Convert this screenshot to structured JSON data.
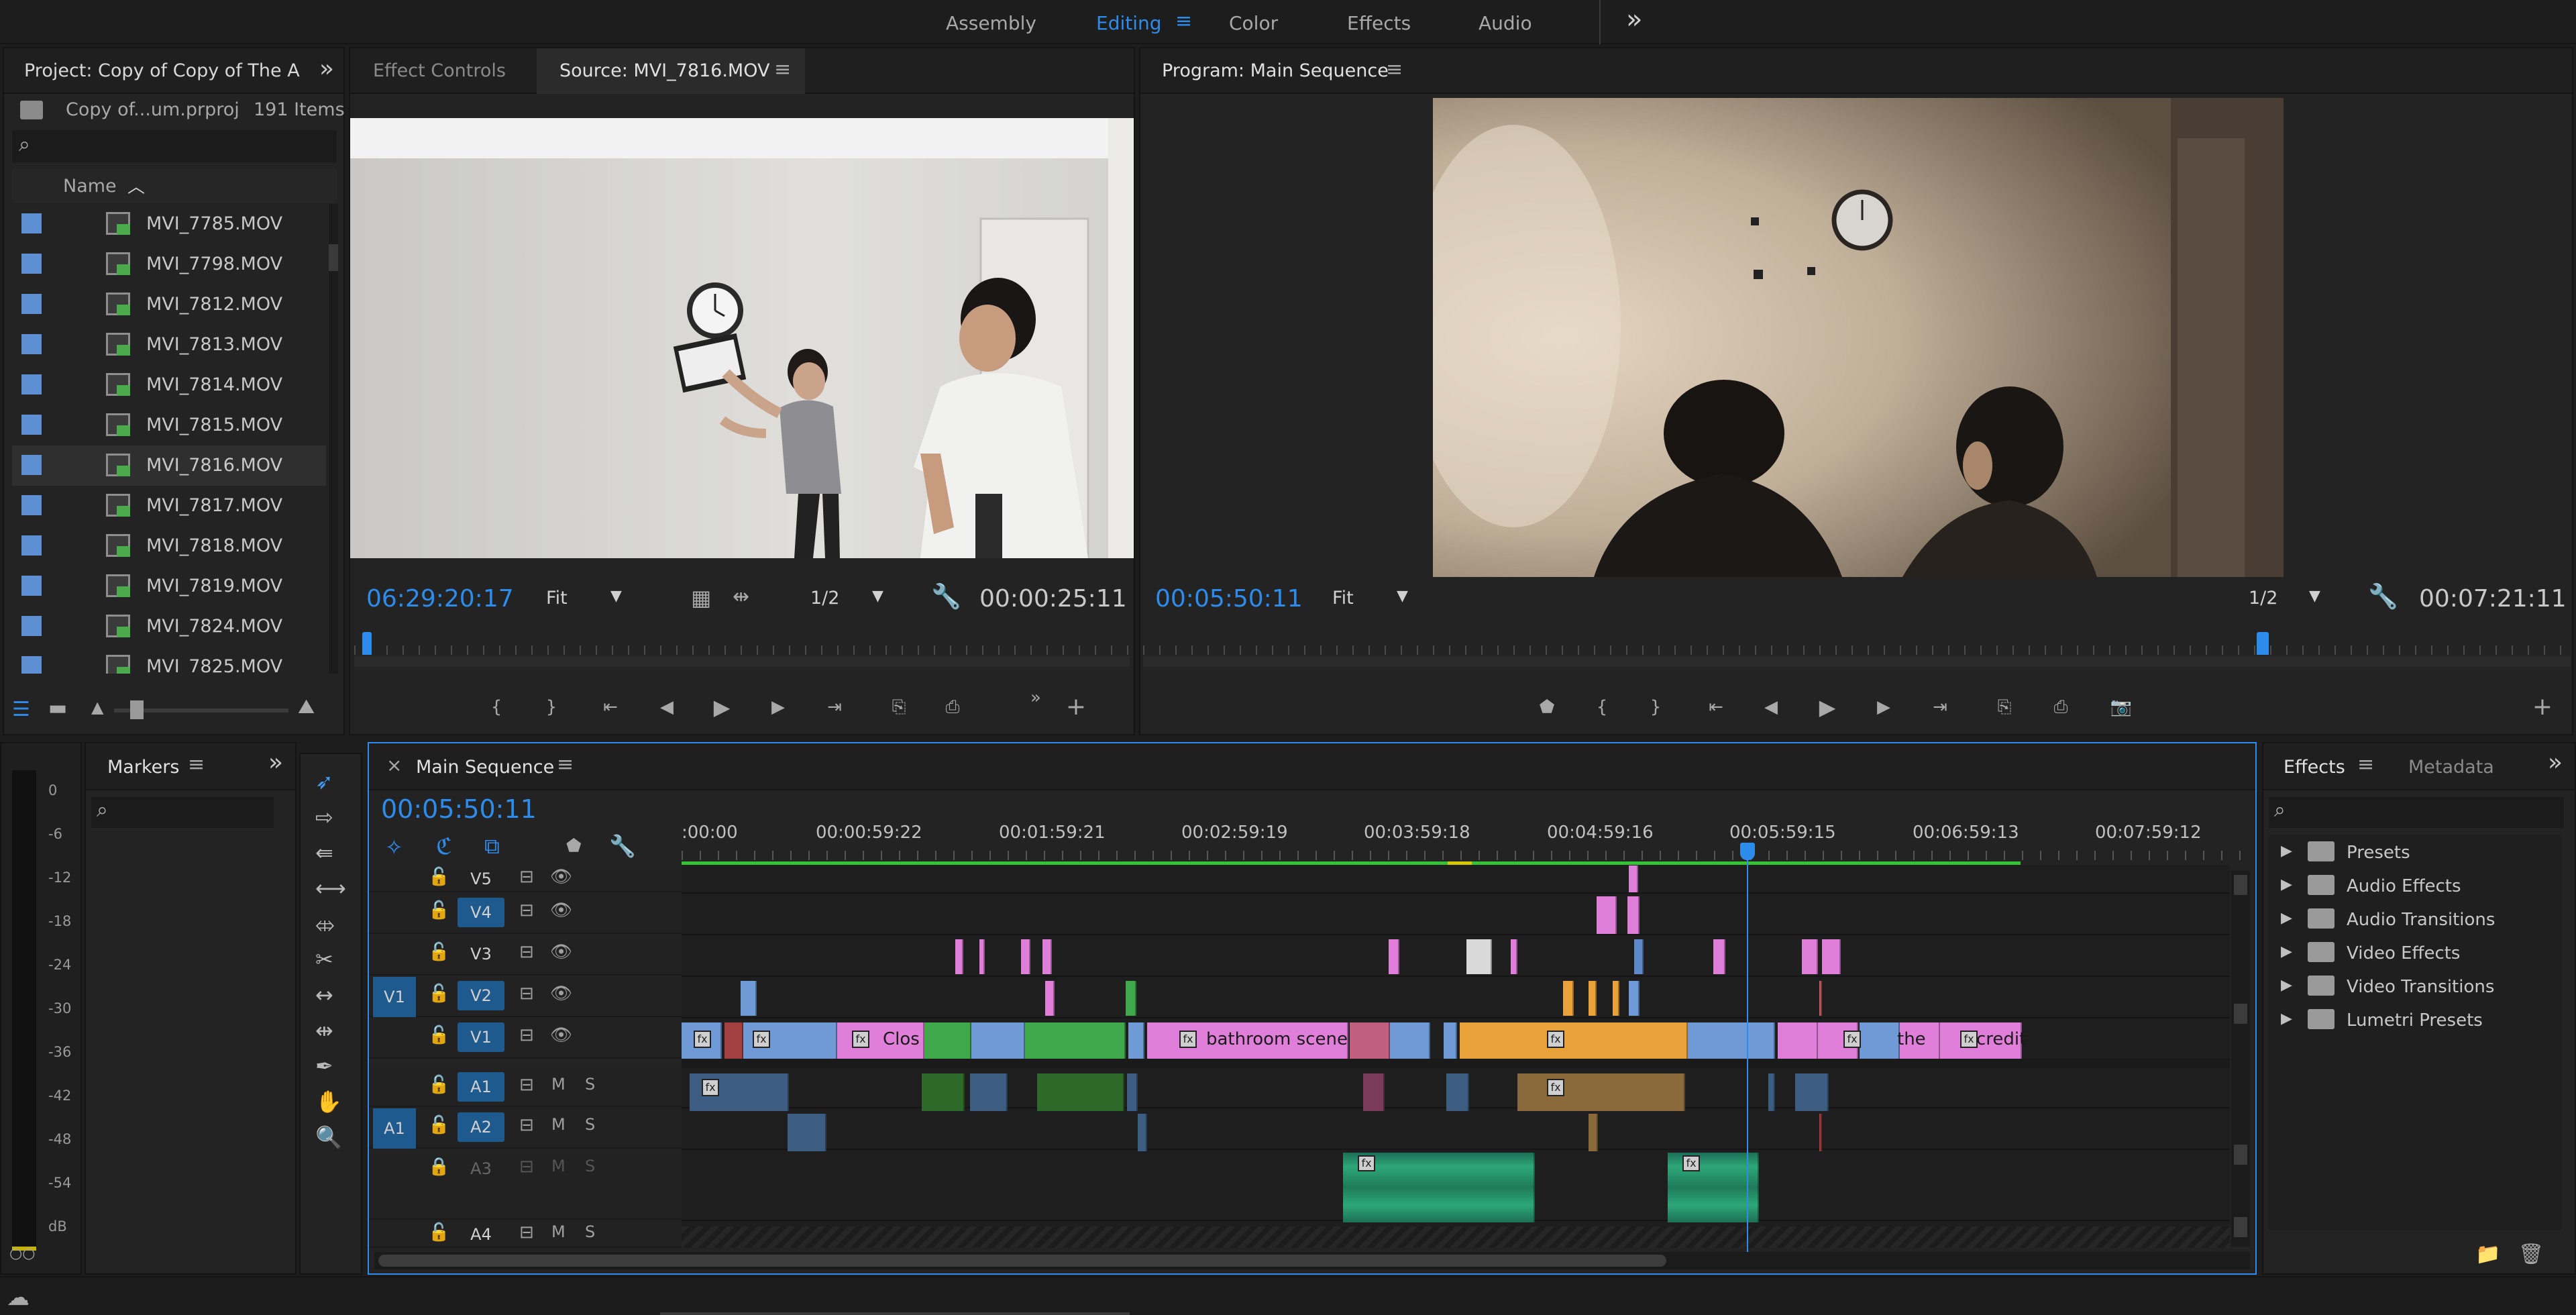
{
  "workspaces": {
    "tabs": [
      "Assembly",
      "Editing",
      "Color",
      "Effects",
      "Audio"
    ],
    "active": "Editing",
    "more": "»"
  },
  "project": {
    "title": "Project: Copy of Copy of The A",
    "file": "Copy of...um.prproj",
    "item_count": "191 Items",
    "column_name": "Name",
    "files": [
      "MVI_7785.MOV",
      "MVI_7798.MOV",
      "MVI_7812.MOV",
      "MVI_7813.MOV",
      "MVI_7814.MOV",
      "MVI_7815.MOV",
      "MVI_7816.MOV",
      "MVI_7817.MOV",
      "MVI_7818.MOV",
      "MVI_7819.MOV",
      "MVI_7824.MOV",
      "MVI_7825.MOV"
    ],
    "selected": "MVI_7816.MOV"
  },
  "source": {
    "tab_effect_controls": "Effect Controls",
    "tab_source": "Source: MVI_7816.MOV",
    "timecode": "06:29:20:17",
    "fit": "Fit",
    "resolution": "1/2",
    "duration": "00:00:25:11",
    "playhead_fraction": 0.01
  },
  "program": {
    "title": "Program: Main Sequence",
    "timecode": "00:05:50:11",
    "fit": "Fit",
    "resolution": "1/2",
    "duration": "00:07:21:11",
    "playhead_fraction": 0.78
  },
  "markers": {
    "title": "Markers"
  },
  "audio_meter": {
    "labels": [
      "0",
      "-6",
      "-12",
      "-18",
      "-24",
      "-30",
      "-36",
      "-42",
      "-48",
      "-54",
      "dB"
    ]
  },
  "timeline": {
    "title": "Main Sequence",
    "timecode": "00:05:50:11",
    "ruler": [
      ":00:00",
      "00:00:59:22",
      "00:01:59:21",
      "00:02:59:19",
      "00:03:59:18",
      "00:04:59:16",
      "00:05:59:15",
      "00:06:59:13",
      "00:07:59:12"
    ],
    "video_tracks": [
      "V5",
      "V4",
      "V3",
      "V2",
      "V1"
    ],
    "audio_tracks": [
      "A1",
      "A2",
      "A3",
      "A4"
    ],
    "source_patch_video": "V1",
    "source_patch_audio": "A1",
    "clip_labels": [
      "Clos",
      "bathroom scene",
      "the",
      "credit"
    ],
    "mute": "M",
    "solo": "S"
  },
  "effects": {
    "tab_effects": "Effects",
    "tab_metadata": "Metadata",
    "items": [
      "Presets",
      "Audio Effects",
      "Audio Transitions",
      "Video Effects",
      "Video Transitions",
      "Lumetri Presets"
    ]
  },
  "colors": {
    "accent": "#2d8ceb",
    "clip_blue": "#6f9ad6",
    "clip_pink": "#e07fd9",
    "clip_green": "#3fa84a",
    "clip_orange": "#e9a23a",
    "clip_audio_green": "#2da77a"
  }
}
